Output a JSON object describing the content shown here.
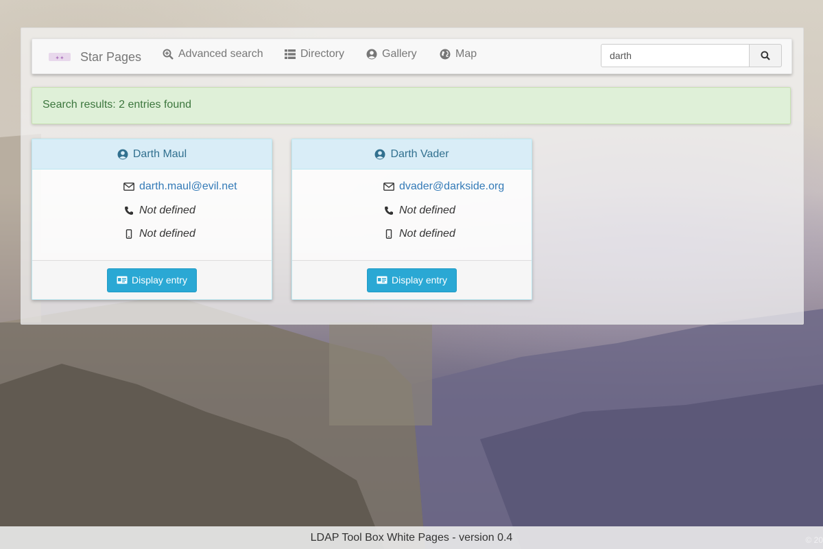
{
  "navbar": {
    "brand": "Star Pages",
    "items": [
      {
        "label": "Advanced search",
        "icon": "search-plus-icon"
      },
      {
        "label": "Directory",
        "icon": "list-icon"
      },
      {
        "label": "Gallery",
        "icon": "user-circle-icon"
      },
      {
        "label": "Map",
        "icon": "globe-icon"
      }
    ],
    "search_value": "darth"
  },
  "alert": {
    "text": "Search results: 2 entries found"
  },
  "entries": [
    {
      "name": "Darth Maul",
      "email": "darth.maul@evil.net",
      "phone": "Not defined",
      "mobile": "Not defined",
      "button_label": "Display entry"
    },
    {
      "name": "Darth Vader",
      "email": "dvader@darkside.org",
      "phone": "Not defined",
      "mobile": "Not defined",
      "button_label": "Display entry"
    }
  ],
  "footer": {
    "text": "LDAP Tool Box White Pages - version 0.4",
    "copyright": "© 20"
  },
  "colors": {
    "alert_bg": "#dff0d8",
    "alert_text": "#3c763d",
    "card_header_bg": "#d9edf7",
    "card_header_text": "#31708f",
    "link": "#337ab7",
    "button": "#2aa8d4"
  }
}
